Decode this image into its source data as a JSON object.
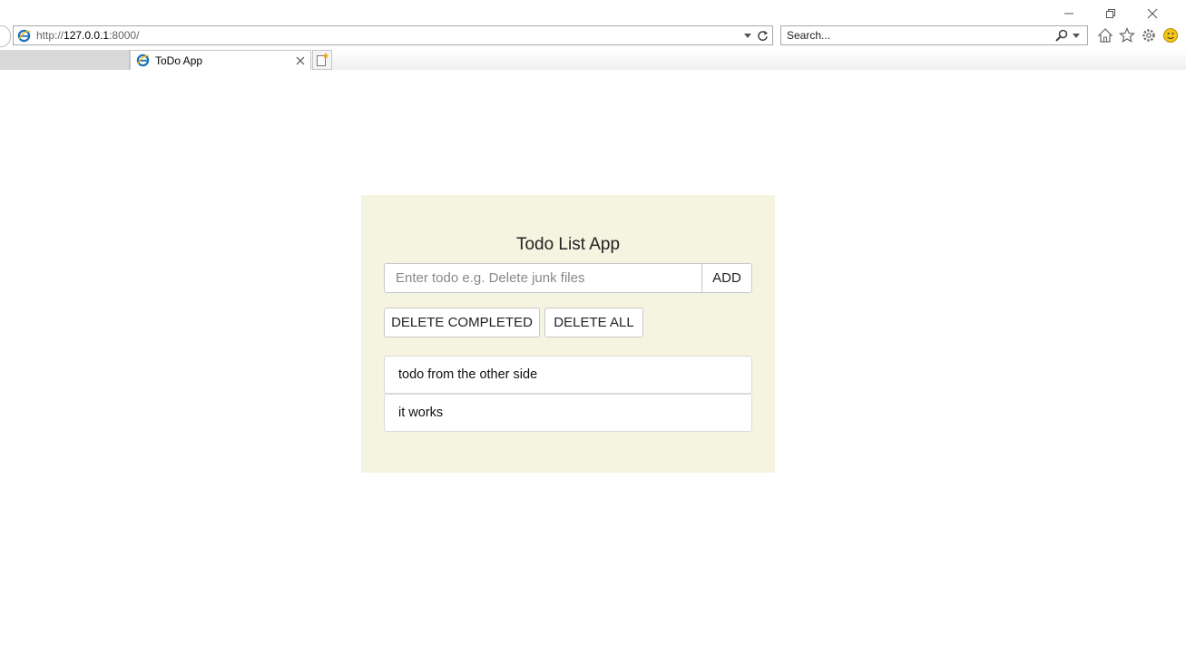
{
  "browser": {
    "url_scheme": "http://",
    "url_host": "127.0.0.1",
    "url_rest": ":8000/",
    "search_placeholder": "Search...",
    "tab_title": "ToDo App",
    "icons": [
      "ie-logo-icon",
      "dropdown-icon",
      "refresh-icon",
      "search-icon",
      "home-icon",
      "favorites-star-icon",
      "settings-gear-icon",
      "feedback-smiley-icon",
      "close-icon",
      "new-tab-icon",
      "minimize-icon",
      "restore-icon"
    ]
  },
  "app": {
    "title": "Todo List App",
    "input_placeholder": "Enter todo e.g. Delete junk files",
    "add_label": "ADD",
    "delete_completed_label": "DELETE COMPLETED",
    "delete_all_label": "DELETE ALL",
    "todos": [
      {
        "text": "todo from the other side"
      },
      {
        "text": "it works"
      }
    ]
  },
  "colors": {
    "card_background": "#f5f4e0",
    "border": "#c8c8c8"
  }
}
